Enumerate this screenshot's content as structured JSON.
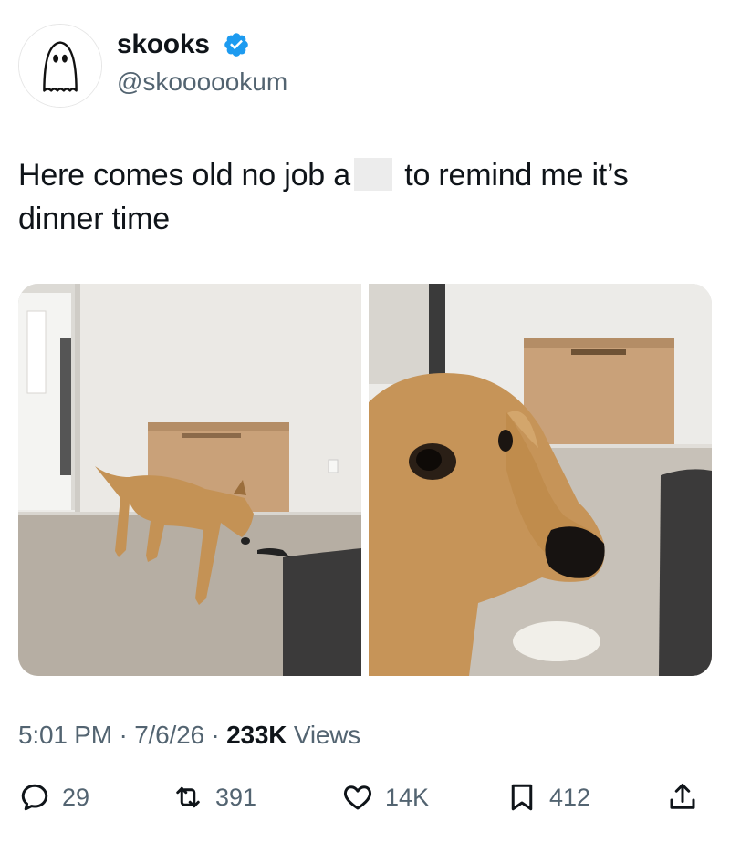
{
  "author": {
    "display_name": "skooks",
    "handle": "@skoooookum",
    "verified": true,
    "avatar_icon": "ghost-icon",
    "verified_color": "#1d9bf0"
  },
  "tweet": {
    "text_before": "Here comes old no job a",
    "text_after": " to remind me it’s dinner time",
    "images": [
      {
        "icon": "photo-dog-standing"
      },
      {
        "icon": "photo-dog-closeup"
      }
    ]
  },
  "meta": {
    "time": "5:01 PM",
    "date": "7/6/26",
    "separator": " · ",
    "views_count": "233K",
    "views_label": " Views"
  },
  "actions": {
    "replies": "29",
    "retweets": "391",
    "likes": "14K",
    "bookmarks": "412"
  },
  "colors": {
    "text": "#0f1419",
    "secondary": "#536471",
    "accent": "#1d9bf0"
  }
}
